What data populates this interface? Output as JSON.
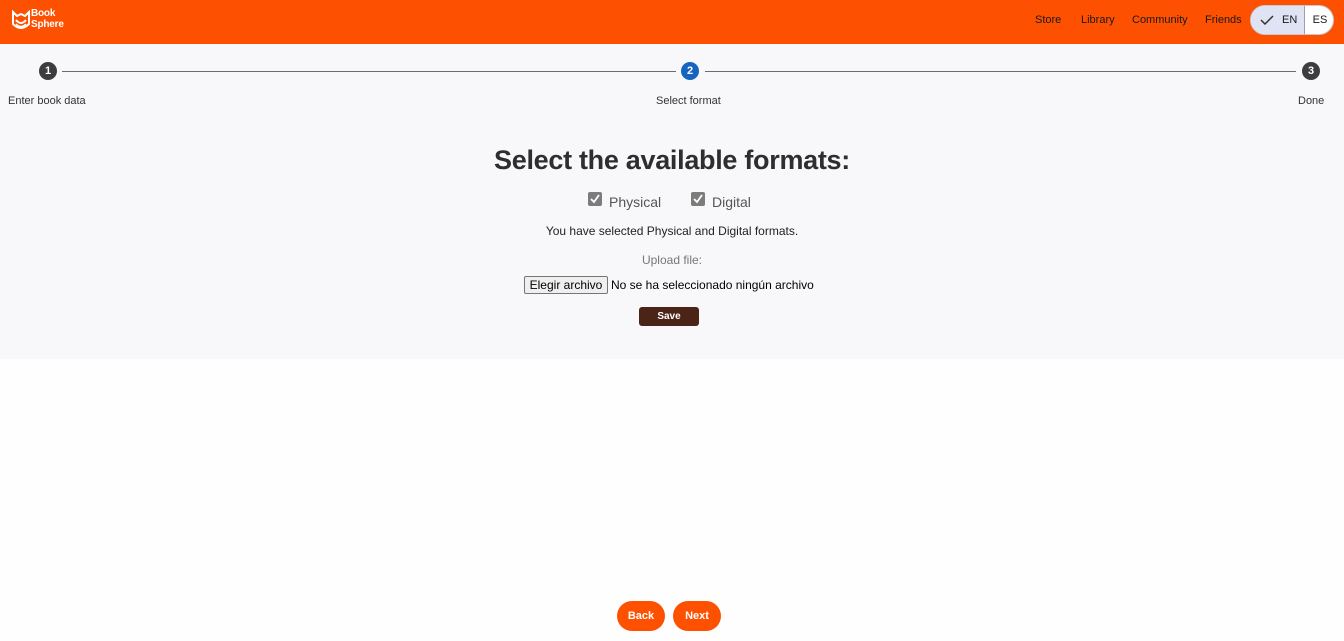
{
  "header": {
    "logo_line1": "Book",
    "logo_line2": "Sphere",
    "nav": [
      "Store",
      "Library",
      "Community",
      "Friends"
    ],
    "lang_selected": "EN",
    "lang_other": "ES",
    "brand_color": "#fd5000"
  },
  "stepper": {
    "steps": [
      {
        "number": "1",
        "label": "Enter book data",
        "state": "completed"
      },
      {
        "number": "2",
        "label": "Select format",
        "state": "active"
      },
      {
        "number": "3",
        "label": "Done",
        "state": "pending"
      }
    ],
    "active_color": "#1565c0",
    "inactive_color": "#3d3d3d"
  },
  "form": {
    "heading": "Select the available formats:",
    "options": [
      {
        "label": "Physical",
        "checked": true
      },
      {
        "label": "Digital",
        "checked": true
      }
    ],
    "selected_message": "You have selected Physical and Digital formats.",
    "upload_label": "Upload file:",
    "file_button": "Elegir archivo",
    "file_status": "No se ha seleccionado ningún archivo",
    "save_label": "Save",
    "save_color": "#4a2416"
  },
  "footer": {
    "back_label": "Back",
    "next_label": "Next"
  }
}
